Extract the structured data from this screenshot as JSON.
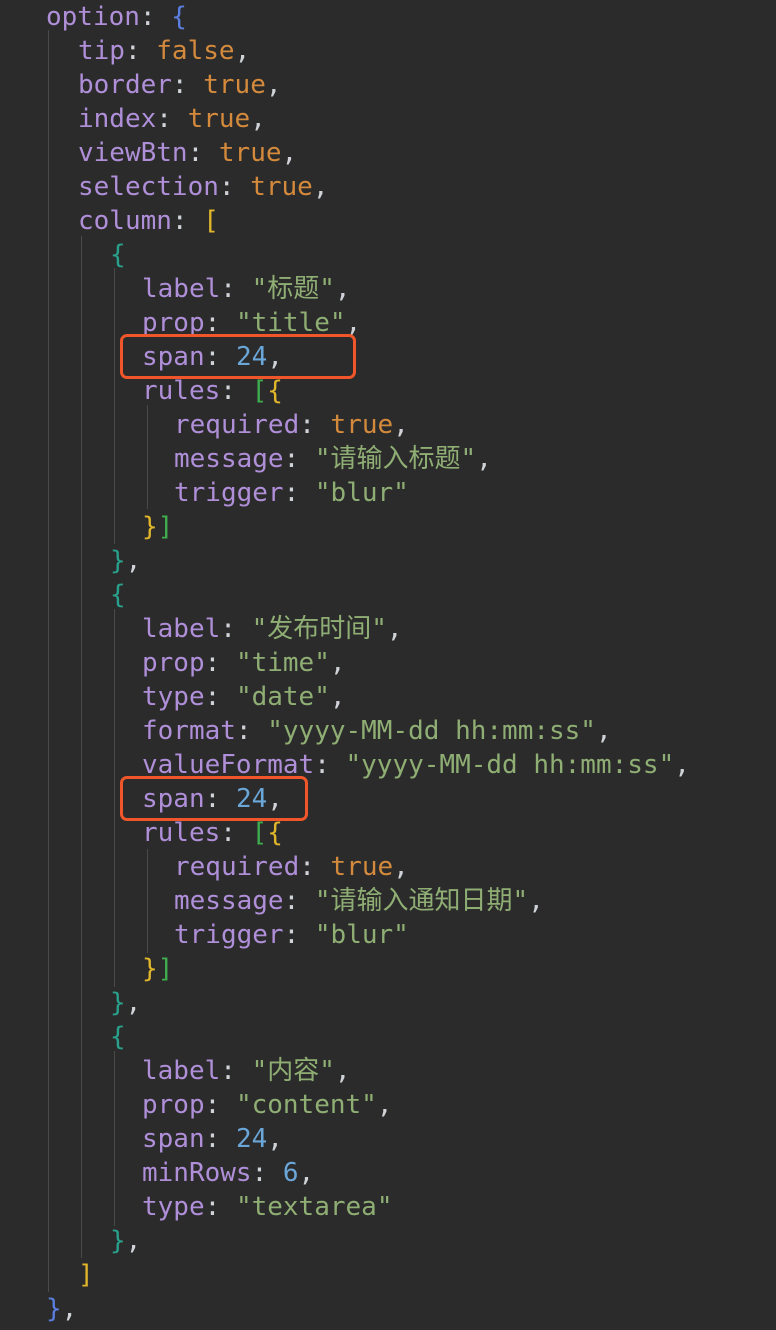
{
  "theme": {
    "background": "#2b2b2b",
    "key": "#b08fd9",
    "punctuation": "#cfd3d8",
    "string": "#8fae74",
    "number": "#6aa6d8",
    "boolean": "#d48a3c",
    "bracket_blue": "#5b7fe0",
    "bracket_gold": "#e0b62a",
    "bracket_teal": "#29a08c",
    "bracket_green": "#3fae4f",
    "highlight_box": "#f0562a"
  },
  "code": {
    "lines": [
      [
        {
          "t": "option",
          "c": "key"
        },
        {
          "t": ": ",
          "c": "p"
        },
        {
          "t": "{",
          "c": "blue"
        }
      ],
      [
        {
          "t": "tip",
          "c": "key"
        },
        {
          "t": ": ",
          "c": "p"
        },
        {
          "t": "false",
          "c": "bool"
        },
        {
          "t": ",",
          "c": "p"
        }
      ],
      [
        {
          "t": "border",
          "c": "key"
        },
        {
          "t": ": ",
          "c": "p"
        },
        {
          "t": "true",
          "c": "bool"
        },
        {
          "t": ",",
          "c": "p"
        }
      ],
      [
        {
          "t": "index",
          "c": "key"
        },
        {
          "t": ": ",
          "c": "p"
        },
        {
          "t": "true",
          "c": "bool"
        },
        {
          "t": ",",
          "c": "p"
        }
      ],
      [
        {
          "t": "viewBtn",
          "c": "key"
        },
        {
          "t": ": ",
          "c": "p"
        },
        {
          "t": "true",
          "c": "bool"
        },
        {
          "t": ",",
          "c": "p"
        }
      ],
      [
        {
          "t": "selection",
          "c": "key"
        },
        {
          "t": ": ",
          "c": "p"
        },
        {
          "t": "true",
          "c": "bool"
        },
        {
          "t": ",",
          "c": "p"
        }
      ],
      [
        {
          "t": "column",
          "c": "key"
        },
        {
          "t": ": ",
          "c": "p"
        },
        {
          "t": "[",
          "c": "gold"
        }
      ],
      [
        {
          "t": "{",
          "c": "teal"
        }
      ],
      [
        {
          "t": "label",
          "c": "key"
        },
        {
          "t": ": ",
          "c": "p"
        },
        {
          "t": "\"标题\"",
          "c": "str"
        },
        {
          "t": ",",
          "c": "p"
        }
      ],
      [
        {
          "t": "prop",
          "c": "key"
        },
        {
          "t": ": ",
          "c": "p"
        },
        {
          "t": "\"title\"",
          "c": "str"
        },
        {
          "t": ",",
          "c": "p"
        }
      ],
      [
        {
          "t": "span",
          "c": "key"
        },
        {
          "t": ": ",
          "c": "p"
        },
        {
          "t": "24",
          "c": "num"
        },
        {
          "t": ",",
          "c": "p"
        }
      ],
      [
        {
          "t": "rules",
          "c": "key"
        },
        {
          "t": ": ",
          "c": "p"
        },
        {
          "t": "[",
          "c": "green"
        },
        {
          "t": "{",
          "c": "gold"
        }
      ],
      [
        {
          "t": "required",
          "c": "key"
        },
        {
          "t": ": ",
          "c": "p"
        },
        {
          "t": "true",
          "c": "bool"
        },
        {
          "t": ",",
          "c": "p"
        }
      ],
      [
        {
          "t": "message",
          "c": "key"
        },
        {
          "t": ": ",
          "c": "p"
        },
        {
          "t": "\"请输入标题\"",
          "c": "str"
        },
        {
          "t": ",",
          "c": "p"
        }
      ],
      [
        {
          "t": "trigger",
          "c": "key"
        },
        {
          "t": ": ",
          "c": "p"
        },
        {
          "t": "\"blur\"",
          "c": "str"
        }
      ],
      [
        {
          "t": "}",
          "c": "gold"
        },
        {
          "t": "]",
          "c": "green"
        }
      ],
      [
        {
          "t": "}",
          "c": "teal"
        },
        {
          "t": ",",
          "c": "p"
        }
      ],
      [
        {
          "t": "{",
          "c": "teal"
        }
      ],
      [
        {
          "t": "label",
          "c": "key"
        },
        {
          "t": ": ",
          "c": "p"
        },
        {
          "t": "\"发布时间\"",
          "c": "str"
        },
        {
          "t": ",",
          "c": "p"
        }
      ],
      [
        {
          "t": "prop",
          "c": "key"
        },
        {
          "t": ": ",
          "c": "p"
        },
        {
          "t": "\"time\"",
          "c": "str"
        },
        {
          "t": ",",
          "c": "p"
        }
      ],
      [
        {
          "t": "type",
          "c": "key"
        },
        {
          "t": ": ",
          "c": "p"
        },
        {
          "t": "\"date\"",
          "c": "str"
        },
        {
          "t": ",",
          "c": "p"
        }
      ],
      [
        {
          "t": "format",
          "c": "key"
        },
        {
          "t": ": ",
          "c": "p"
        },
        {
          "t": "\"yyyy-MM-dd hh:mm:ss\"",
          "c": "str"
        },
        {
          "t": ",",
          "c": "p"
        }
      ],
      [
        {
          "t": "valueFormat",
          "c": "key"
        },
        {
          "t": ": ",
          "c": "p"
        },
        {
          "t": "\"yyyy-MM-dd hh:mm:ss\"",
          "c": "str"
        },
        {
          "t": ",",
          "c": "p"
        }
      ],
      [
        {
          "t": "span",
          "c": "key"
        },
        {
          "t": ": ",
          "c": "p"
        },
        {
          "t": "24",
          "c": "num"
        },
        {
          "t": ",",
          "c": "p"
        }
      ],
      [
        {
          "t": "rules",
          "c": "key"
        },
        {
          "t": ": ",
          "c": "p"
        },
        {
          "t": "[",
          "c": "green"
        },
        {
          "t": "{",
          "c": "gold"
        }
      ],
      [
        {
          "t": "required",
          "c": "key"
        },
        {
          "t": ": ",
          "c": "p"
        },
        {
          "t": "true",
          "c": "bool"
        },
        {
          "t": ",",
          "c": "p"
        }
      ],
      [
        {
          "t": "message",
          "c": "key"
        },
        {
          "t": ": ",
          "c": "p"
        },
        {
          "t": "\"请输入通知日期\"",
          "c": "str"
        },
        {
          "t": ",",
          "c": "p"
        }
      ],
      [
        {
          "t": "trigger",
          "c": "key"
        },
        {
          "t": ": ",
          "c": "p"
        },
        {
          "t": "\"blur\"",
          "c": "str"
        }
      ],
      [
        {
          "t": "}",
          "c": "gold"
        },
        {
          "t": "]",
          "c": "green"
        }
      ],
      [
        {
          "t": "}",
          "c": "teal"
        },
        {
          "t": ",",
          "c": "p"
        }
      ],
      [
        {
          "t": "{",
          "c": "teal"
        }
      ],
      [
        {
          "t": "label",
          "c": "key"
        },
        {
          "t": ": ",
          "c": "p"
        },
        {
          "t": "\"内容\"",
          "c": "str"
        },
        {
          "t": ",",
          "c": "p"
        }
      ],
      [
        {
          "t": "prop",
          "c": "key"
        },
        {
          "t": ": ",
          "c": "p"
        },
        {
          "t": "\"content\"",
          "c": "str"
        },
        {
          "t": ",",
          "c": "p"
        }
      ],
      [
        {
          "t": "span",
          "c": "key"
        },
        {
          "t": ": ",
          "c": "p"
        },
        {
          "t": "24",
          "c": "num"
        },
        {
          "t": ",",
          "c": "p"
        }
      ],
      [
        {
          "t": "minRows",
          "c": "key"
        },
        {
          "t": ": ",
          "c": "p"
        },
        {
          "t": "6",
          "c": "num"
        },
        {
          "t": ",",
          "c": "p"
        }
      ],
      [
        {
          "t": "type",
          "c": "key"
        },
        {
          "t": ": ",
          "c": "p"
        },
        {
          "t": "\"textarea\"",
          "c": "str"
        }
      ],
      [
        {
          "t": "}",
          "c": "teal"
        },
        {
          "t": ",",
          "c": "p"
        }
      ],
      [
        {
          "t": "]",
          "c": "gold"
        }
      ],
      [
        {
          "t": "}",
          "c": "blue"
        },
        {
          "t": ",",
          "c": "p"
        }
      ]
    ],
    "highlighted_lines": [
      10,
      23
    ]
  }
}
